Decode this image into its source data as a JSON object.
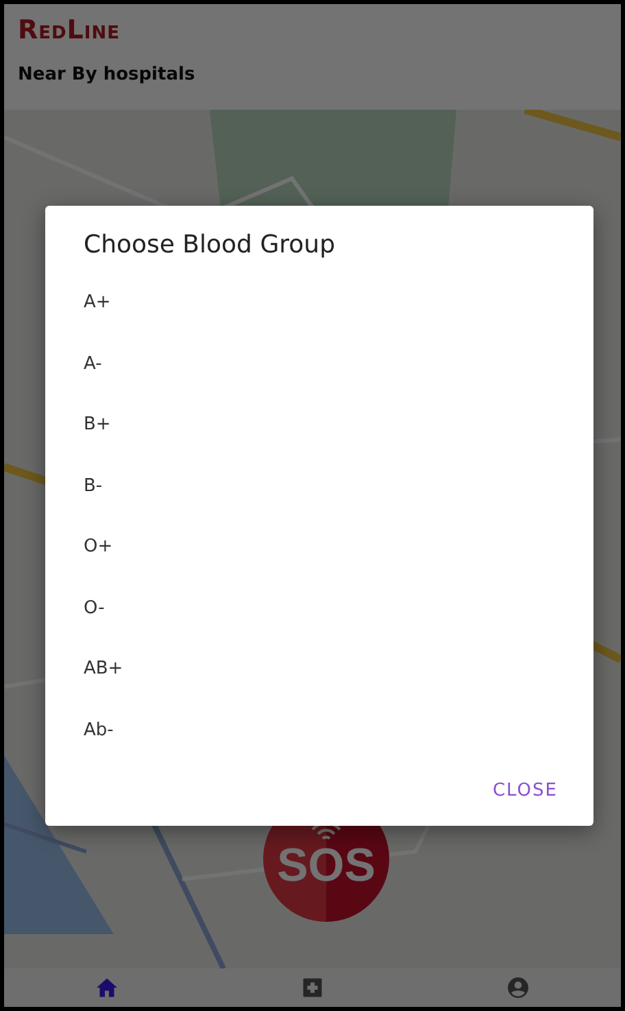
{
  "app": {
    "title": "RedLine",
    "subtitle": "Near By hospitals"
  },
  "sos_button": {
    "label": "SOS"
  },
  "bottom_nav": [
    {
      "kind": "home",
      "selected": true
    },
    {
      "kind": "plus",
      "selected": false
    },
    {
      "kind": "account",
      "selected": false
    }
  ],
  "dialog": {
    "title": "Choose Blood Group",
    "options": [
      "A+",
      "A-",
      "B+",
      "B-",
      "O+",
      "O-",
      "AB+",
      "Ab-"
    ],
    "button": "CLOSE"
  }
}
